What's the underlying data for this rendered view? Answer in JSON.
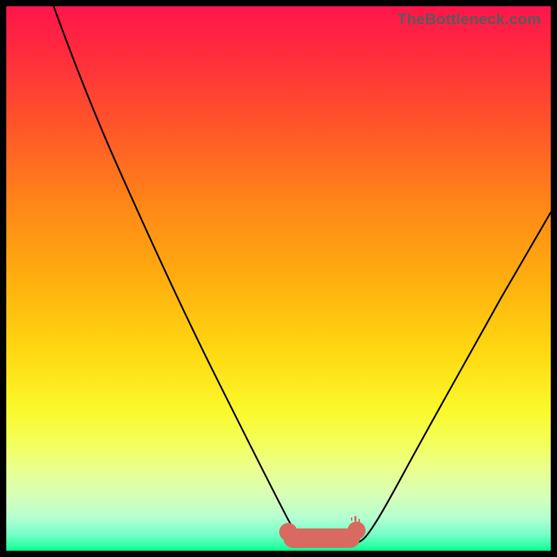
{
  "watermark": "TheBottleneck.com",
  "colors": {
    "blob": "#d86a62",
    "curve": "#000000",
    "frame_bg_top": "#ff154c",
    "frame_bg_bottom": "#00ff88",
    "page_bg": "#000000"
  },
  "chart_data": {
    "type": "line",
    "title": "",
    "xlabel": "",
    "ylabel": "",
    "xlim": [
      0,
      100
    ],
    "ylim": [
      0,
      100
    ],
    "series": [
      {
        "name": "curve",
        "x": [
          0,
          4,
          10,
          16,
          22,
          28,
          34,
          40,
          44,
          48,
          51,
          54,
          58,
          62,
          66,
          72,
          80,
          88,
          96,
          100
        ],
        "y": [
          100,
          94,
          84,
          73,
          62,
          51,
          40,
          28,
          19,
          10,
          4,
          1,
          0,
          0,
          4,
          12,
          24,
          38,
          52,
          60
        ]
      }
    ],
    "annotations": [
      {
        "kind": "flat-region",
        "x_from": 51,
        "x_to": 62,
        "y": 0
      }
    ],
    "grid": false,
    "legend": false
  }
}
